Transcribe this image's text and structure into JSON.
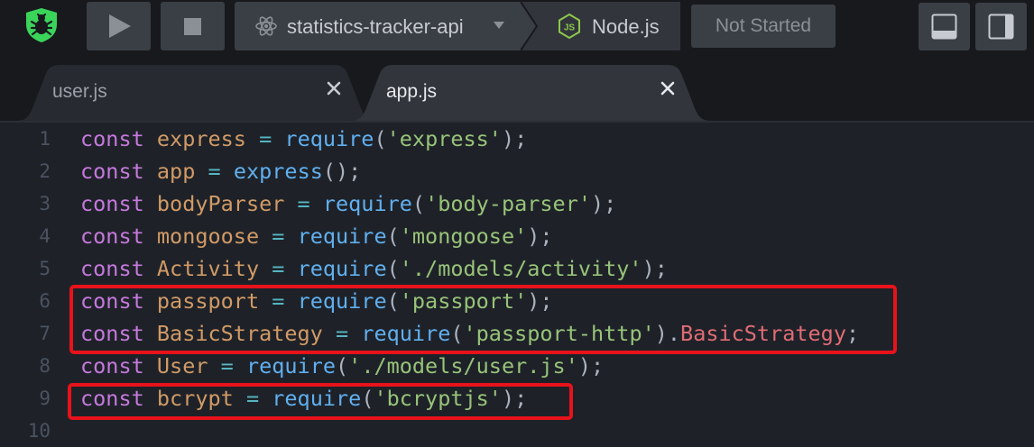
{
  "toolbar": {
    "project_name": "statistics-tracker-api",
    "runtime": "Node.js",
    "status": "Not Started"
  },
  "tabs": [
    {
      "label": "user.js",
      "active": false
    },
    {
      "label": "app.js",
      "active": true
    }
  ],
  "colors": {
    "keyword": "#c678dd",
    "variable": "#d19a66",
    "operator": "#56b6c2",
    "function": "#61afef",
    "string": "#98c379",
    "property": "#e06c75",
    "highlight_border": "#e8121b",
    "logo": "#3ad45b"
  },
  "editor": {
    "lines": [
      {
        "num": "1",
        "tokens": [
          {
            "t": "const",
            "c": "kw"
          },
          {
            "t": " "
          },
          {
            "t": "express",
            "c": "var"
          },
          {
            "t": " "
          },
          {
            "t": "=",
            "c": "op"
          },
          {
            "t": " "
          },
          {
            "t": "require",
            "c": "fn"
          },
          {
            "t": "(",
            "c": "pn"
          },
          {
            "t": "'express'",
            "c": "str"
          },
          {
            "t": ");",
            "c": "pn"
          }
        ]
      },
      {
        "num": "2",
        "tokens": [
          {
            "t": "const",
            "c": "kw"
          },
          {
            "t": " "
          },
          {
            "t": "app",
            "c": "var"
          },
          {
            "t": " "
          },
          {
            "t": "=",
            "c": "op"
          },
          {
            "t": " "
          },
          {
            "t": "express",
            "c": "fn"
          },
          {
            "t": "();",
            "c": "pn"
          }
        ]
      },
      {
        "num": "3",
        "tokens": [
          {
            "t": "const",
            "c": "kw"
          },
          {
            "t": " "
          },
          {
            "t": "bodyParser",
            "c": "var"
          },
          {
            "t": " "
          },
          {
            "t": "=",
            "c": "op"
          },
          {
            "t": " "
          },
          {
            "t": "require",
            "c": "fn"
          },
          {
            "t": "(",
            "c": "pn"
          },
          {
            "t": "'body-parser'",
            "c": "str"
          },
          {
            "t": ");",
            "c": "pn"
          }
        ]
      },
      {
        "num": "4",
        "tokens": [
          {
            "t": "const",
            "c": "kw"
          },
          {
            "t": " "
          },
          {
            "t": "mongoose",
            "c": "var"
          },
          {
            "t": " "
          },
          {
            "t": "=",
            "c": "op"
          },
          {
            "t": " "
          },
          {
            "t": "require",
            "c": "fn"
          },
          {
            "t": "(",
            "c": "pn"
          },
          {
            "t": "'mongoose'",
            "c": "str"
          },
          {
            "t": ");",
            "c": "pn"
          }
        ]
      },
      {
        "num": "5",
        "tokens": [
          {
            "t": "const",
            "c": "kw"
          },
          {
            "t": " "
          },
          {
            "t": "Activity",
            "c": "var"
          },
          {
            "t": " "
          },
          {
            "t": "=",
            "c": "op"
          },
          {
            "t": " "
          },
          {
            "t": "require",
            "c": "fn"
          },
          {
            "t": "(",
            "c": "pn"
          },
          {
            "t": "'./models/activity'",
            "c": "str"
          },
          {
            "t": ");",
            "c": "pn"
          }
        ]
      },
      {
        "num": "6",
        "tokens": [
          {
            "t": "const",
            "c": "kw"
          },
          {
            "t": " "
          },
          {
            "t": "passport",
            "c": "var"
          },
          {
            "t": " "
          },
          {
            "t": "=",
            "c": "op"
          },
          {
            "t": " "
          },
          {
            "t": "require",
            "c": "fn"
          },
          {
            "t": "(",
            "c": "pn"
          },
          {
            "t": "'passport'",
            "c": "str"
          },
          {
            "t": ");",
            "c": "pn"
          }
        ]
      },
      {
        "num": "7",
        "tokens": [
          {
            "t": "const",
            "c": "kw"
          },
          {
            "t": " "
          },
          {
            "t": "BasicStrategy",
            "c": "var"
          },
          {
            "t": " "
          },
          {
            "t": "=",
            "c": "op"
          },
          {
            "t": " "
          },
          {
            "t": "require",
            "c": "fn"
          },
          {
            "t": "(",
            "c": "pn"
          },
          {
            "t": "'passport-http'",
            "c": "str"
          },
          {
            "t": ").",
            "c": "pn"
          },
          {
            "t": "BasicStrategy",
            "c": "prop"
          },
          {
            "t": ";",
            "c": "pn"
          }
        ]
      },
      {
        "num": "8",
        "tokens": [
          {
            "t": "const",
            "c": "kw"
          },
          {
            "t": " "
          },
          {
            "t": "User",
            "c": "var"
          },
          {
            "t": " "
          },
          {
            "t": "=",
            "c": "op"
          },
          {
            "t": " "
          },
          {
            "t": "require",
            "c": "fn"
          },
          {
            "t": "(",
            "c": "pn"
          },
          {
            "t": "'./models/user.js'",
            "c": "str"
          },
          {
            "t": ");",
            "c": "pn"
          }
        ]
      },
      {
        "num": "9",
        "tokens": [
          {
            "t": "const",
            "c": "kw"
          },
          {
            "t": " "
          },
          {
            "t": "bcrypt",
            "c": "var"
          },
          {
            "t": " "
          },
          {
            "t": "=",
            "c": "op"
          },
          {
            "t": " "
          },
          {
            "t": "require",
            "c": "fn"
          },
          {
            "t": "(",
            "c": "pn"
          },
          {
            "t": "'bcryptjs'",
            "c": "str"
          },
          {
            "t": ");",
            "c": "pn"
          }
        ]
      },
      {
        "num": "10",
        "tokens": []
      }
    ]
  }
}
